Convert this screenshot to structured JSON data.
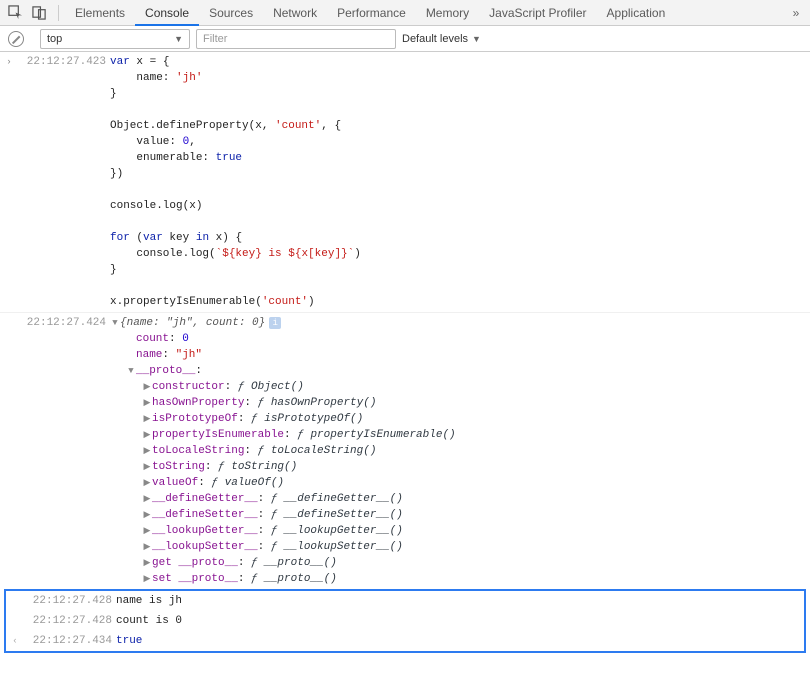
{
  "tabs": [
    "Elements",
    "Console",
    "Sources",
    "Network",
    "Performance",
    "Memory",
    "JavaScript Profiler",
    "Application"
  ],
  "activeTab": "Console",
  "contextSelector": "top",
  "filterPlaceholder": "Filter",
  "levelSelector": "Default levels",
  "entries": {
    "input": {
      "ts": "22:12:27.423",
      "code": "var x = {\n    name: 'jh'\n}\n\nObject.defineProperty(x, 'count', {\n    value: 0,\n    enumerable: true\n})\n\nconsole.log(x)\n\nfor (var key in x) {\n    console.log(`${key} is ${x[key]}`)\n}\n\nx.propertyIsEnumerable('count')"
    },
    "objectLog": {
      "ts": "22:12:27.424",
      "summary": "{name: \"jh\", count: 0}",
      "props": [
        {
          "key": "count",
          "val": "0",
          "valType": "num"
        },
        {
          "key": "name",
          "val": "\"jh\"",
          "valType": "str"
        }
      ],
      "protoLabel": "__proto__",
      "protoEntries": [
        {
          "key": "constructor",
          "val": "Object()"
        },
        {
          "key": "hasOwnProperty",
          "val": "hasOwnProperty()"
        },
        {
          "key": "isPrototypeOf",
          "val": "isPrototypeOf()"
        },
        {
          "key": "propertyIsEnumerable",
          "val": "propertyIsEnumerable()"
        },
        {
          "key": "toLocaleString",
          "val": "toLocaleString()"
        },
        {
          "key": "toString",
          "val": "toString()"
        },
        {
          "key": "valueOf",
          "val": "valueOf()"
        },
        {
          "key": "__defineGetter__",
          "val": "__defineGetter__()"
        },
        {
          "key": "__defineSetter__",
          "val": "__defineSetter__()"
        },
        {
          "key": "__lookupGetter__",
          "val": "__lookupGetter__()"
        },
        {
          "key": "__lookupSetter__",
          "val": "__lookupSetter__()"
        },
        {
          "key": "get __proto__",
          "val": "__proto__()"
        },
        {
          "key": "set __proto__",
          "val": "__proto__()"
        }
      ],
      "fSymbol": "ƒ"
    },
    "log1": {
      "ts": "22:12:27.428",
      "text": "name is jh"
    },
    "log2": {
      "ts": "22:12:27.428",
      "text": "count is 0"
    },
    "result": {
      "ts": "22:12:27.434",
      "text": "true"
    }
  }
}
